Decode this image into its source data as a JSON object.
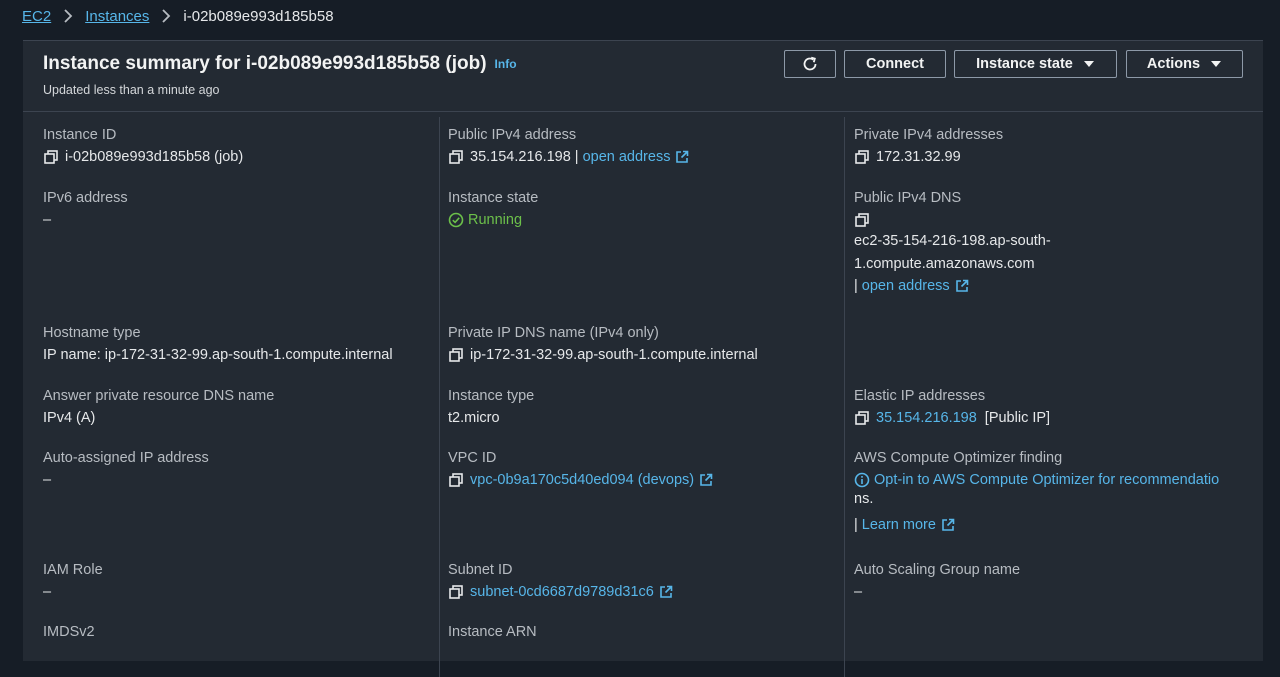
{
  "breadcrumb": {
    "root": "EC2",
    "instances": "Instances",
    "current": "i-02b089e993d185b58"
  },
  "header": {
    "title": "Instance summary for i-02b089e993d185b58 (job)",
    "info": "Info",
    "subtitle": "Updated less than a minute ago",
    "connect": "Connect",
    "instance_state": "Instance state",
    "actions": "Actions"
  },
  "fields": {
    "instance_id": {
      "label": "Instance ID",
      "value": "i-02b089e993d185b58 (job)"
    },
    "public_ipv4": {
      "label": "Public IPv4 address",
      "value": "35.154.216.198",
      "separator": "|",
      "link": "open address"
    },
    "private_ipv4": {
      "label": "Private IPv4 addresses",
      "value": "172.31.32.99"
    },
    "ipv6": {
      "label": "IPv6 address",
      "value": "–"
    },
    "instance_state": {
      "label": "Instance state",
      "value": "Running"
    },
    "public_dns": {
      "label": "Public IPv4 DNS",
      "line1": "ec2-35-154-216-198.ap-south-",
      "line2": "1.compute.amazonaws.com",
      "separator": "|",
      "link": "open address"
    },
    "hostname_type": {
      "label": "Hostname type",
      "value": "IP name: ip-172-31-32-99.ap-south-1.compute.internal"
    },
    "private_dns": {
      "label": "Private IP DNS name (IPv4 only)",
      "value": "ip-172-31-32-99.ap-south-1.compute.internal"
    },
    "answer_dns": {
      "label": "Answer private resource DNS name",
      "value": "IPv4 (A)"
    },
    "instance_type": {
      "label": "Instance type",
      "value": "t2.micro"
    },
    "elastic_ip": {
      "label": "Elastic IP addresses",
      "value": "35.154.216.198",
      "suffix": "[Public IP]"
    },
    "auto_ip": {
      "label": "Auto-assigned IP address",
      "value": "–"
    },
    "vpc_id": {
      "label": "VPC ID",
      "value": "vpc-0b9a170c5d40ed094 (devops)"
    },
    "optimizer": {
      "label": "AWS Compute Optimizer finding",
      "line1": "Opt-in to AWS Compute Optimizer for recommendatio",
      "line2": "ns.",
      "separator": "|",
      "link": "Learn more"
    },
    "iam_role": {
      "label": "IAM Role",
      "value": "–"
    },
    "subnet_id": {
      "label": "Subnet ID",
      "value": "subnet-0cd6687d9789d31c6"
    },
    "asg_name": {
      "label": "Auto Scaling Group name",
      "value": "–"
    },
    "imdsv2": {
      "label": "IMDSv2"
    },
    "instance_arn": {
      "label": "Instance ARN"
    }
  },
  "colors": {
    "background": "#161d26",
    "panel": "#232a33",
    "link": "#57b6e9",
    "running": "#6cc04a"
  }
}
